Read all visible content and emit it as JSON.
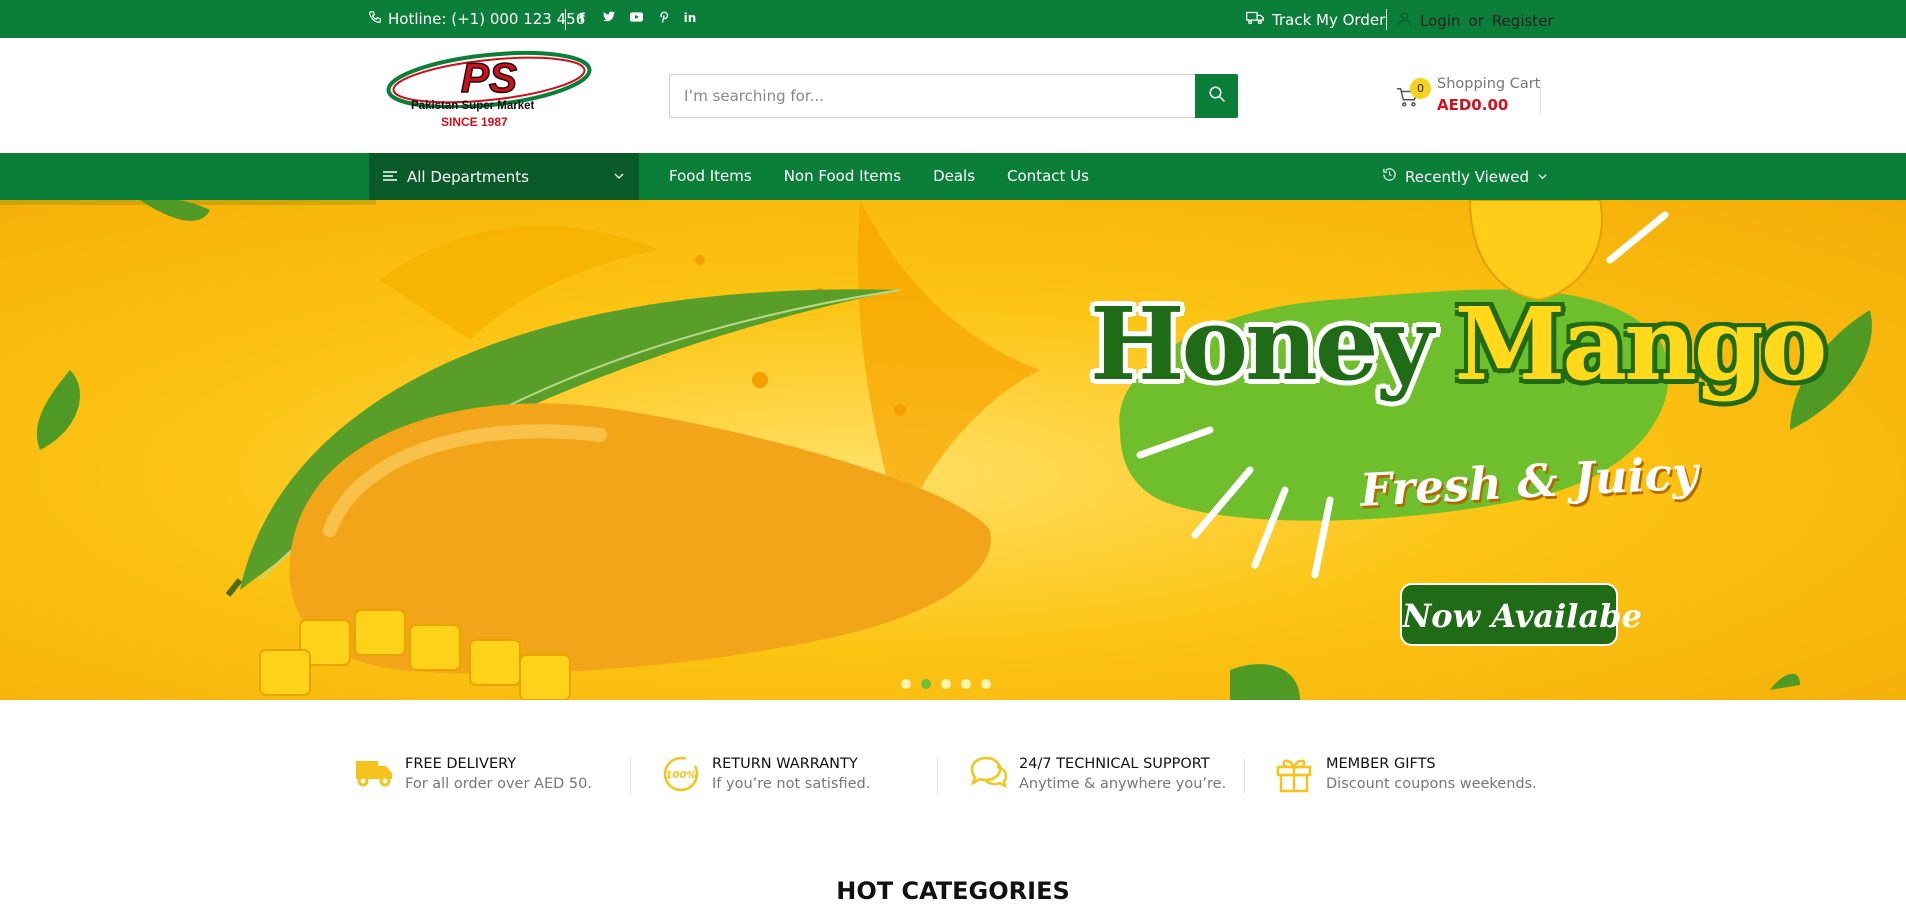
{
  "topbar": {
    "hotline": "Hotline: (+1) 000 123 456",
    "socials": [
      "f",
      "t",
      "yt",
      "p",
      "in"
    ],
    "track_order": "Track My Order",
    "login": "Login",
    "or": "or",
    "register": "Register"
  },
  "logo": {
    "mark": "PS",
    "name": "Pakistan Super Market",
    "since": "SINCE 1987"
  },
  "search": {
    "placeholder": "I’m searching for..."
  },
  "cart": {
    "count": "0",
    "label": "Shopping Cart",
    "amount": "AED0.00"
  },
  "nav": {
    "departments": "All Departments",
    "links": [
      "Food Items",
      "Non Food Items",
      "Deals",
      "Contact Us"
    ],
    "recently_viewed": "Recently Viewed"
  },
  "hero": {
    "title_1": "Honey",
    "title_2": "Mango",
    "tagline": "Fresh & Juicy",
    "badge": "Now Availabe",
    "slides": 5,
    "active_slide": 2
  },
  "features": [
    {
      "title": "FREE DELIVERY",
      "desc": "For all order over AED 50.",
      "icon": "truck-icon"
    },
    {
      "title": "RETURN WARRANTY",
      "desc": "If you’re not satisfied.",
      "icon": "warranty-100-icon"
    },
    {
      "title": "24/7 TECHNICAL SUPPORT",
      "desc": "Anytime & anywhere you’re.",
      "icon": "chat-bubbles-icon"
    },
    {
      "title": "MEMBER GIFTS",
      "desc": "Discount coupons weekends.",
      "icon": "gift-icon"
    }
  ],
  "section_title": "HOT CATEGORIES",
  "colors": {
    "primary_green": "#0b7f3a",
    "dark_green": "#0a5a2a",
    "accent_yellow": "#f6d31d",
    "price_red": "#d4101c"
  }
}
